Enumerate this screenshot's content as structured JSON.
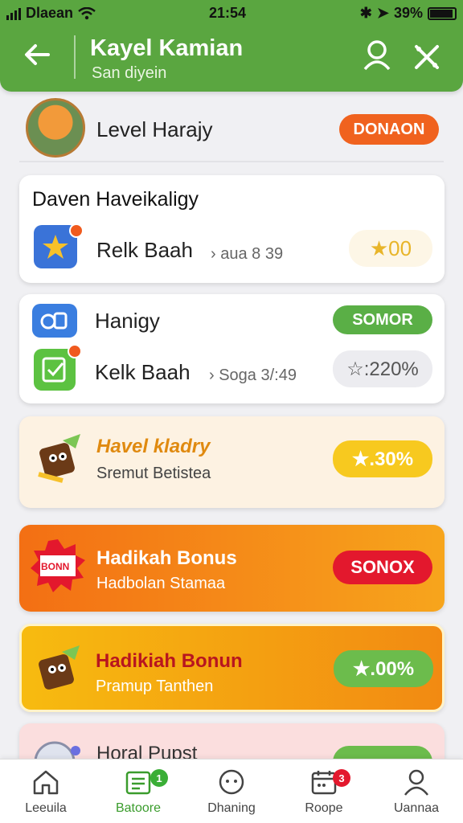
{
  "status_bar": {
    "carrier": "Dlaean",
    "time": "21:54",
    "battery": "39%"
  },
  "header": {
    "title": "Kayel Kamian",
    "subtitle": "San diyein"
  },
  "level": {
    "label": "Level Harajy",
    "button": "DONAON"
  },
  "card1": {
    "heading": "Daven Haveikaligy",
    "row_label": "Relk Baah",
    "row_sub": "› aua 8 39",
    "pill": "★00"
  },
  "card2": {
    "row1_label": "Hanigy",
    "row1_button": "SOMOR",
    "row2_label": "Kelk Baah",
    "row2_sub": "› Soga 3/:49",
    "row2_pill": "☆:220%"
  },
  "card3": {
    "title": "Havel kladry",
    "subtitle": "Sremut Betistea",
    "pill": "★.30%"
  },
  "card4": {
    "title": "Hadikah Bonus",
    "subtitle": "Hadbolan Stamaa",
    "button": "SONOX",
    "icon_text": "BONN"
  },
  "card5": {
    "title": "Hadikiah Bonun",
    "subtitle": "Pramup Tanthen",
    "pill": "★.00%"
  },
  "card6": {
    "title": "Horal Pupst"
  },
  "nav": {
    "items": [
      {
        "label": "Leeuila"
      },
      {
        "label": "Batoore",
        "badge": "1"
      },
      {
        "label": "Dhaning"
      },
      {
        "label": "Roope",
        "badge": "3"
      },
      {
        "label": "Uannaa"
      }
    ]
  },
  "colors": {
    "header": "#5aa640",
    "accent_orange": "#f0621e",
    "accent_green": "#5aaf46",
    "accent_red": "#e3182d"
  }
}
